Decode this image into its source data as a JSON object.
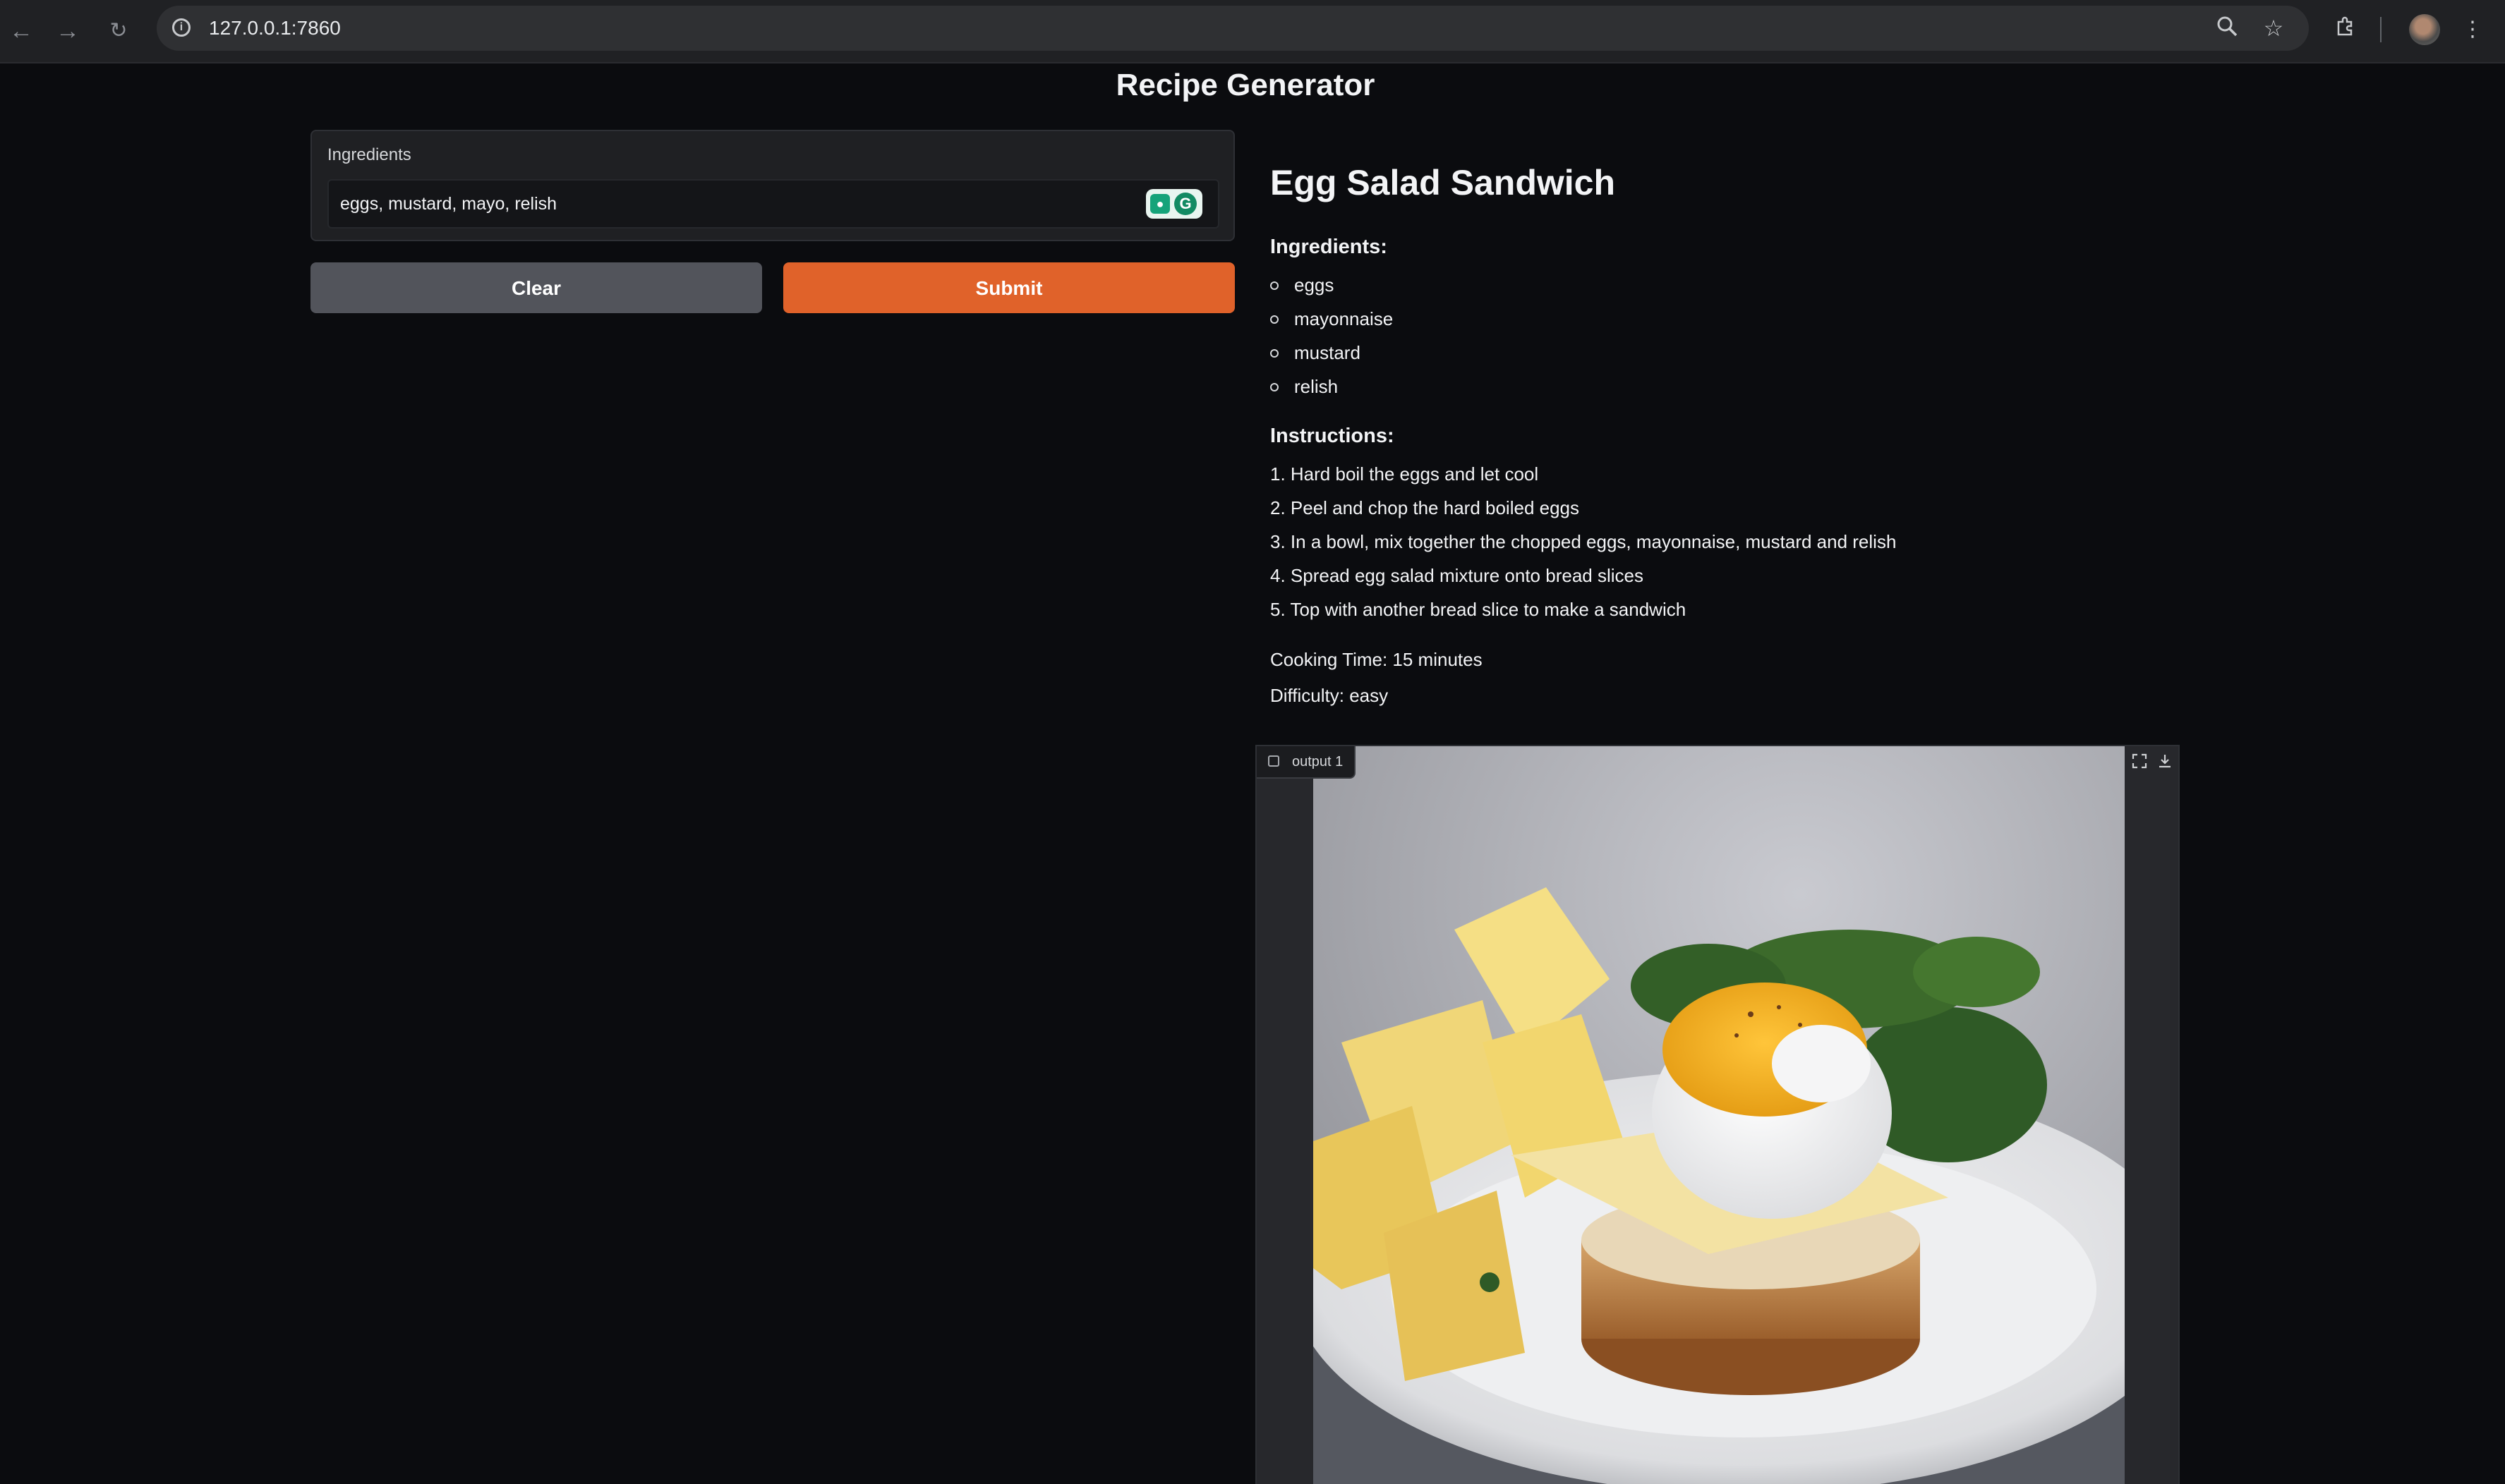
{
  "browser": {
    "url": "127.0.0.1:7860",
    "back_icon": "arrow-left-icon",
    "forward_icon": "arrow-right-icon",
    "reload_icon": "reload-icon"
  },
  "app": {
    "title": "Recipe Generator"
  },
  "input": {
    "label": "Ingredients",
    "value": "eggs, mustard, mayo, relish",
    "placeholder": ""
  },
  "buttons": {
    "clear": "Clear",
    "submit": "Submit"
  },
  "recipe": {
    "title": "Egg Salad Sandwich",
    "ingredients_heading": "Ingredients:",
    "ingredients": [
      "eggs",
      "mayonnaise",
      "mustard",
      "relish"
    ],
    "instructions_heading": "Instructions:",
    "steps": [
      "1. Hard boil the eggs and let cool",
      "2. Peel and chop the hard boiled eggs",
      "3. In a bowl, mix together the chopped eggs, mayonnaise, mustard and relish",
      "4. Spread egg salad mixture onto bread slices",
      "5. Top with another bread slice to make a sandwich"
    ],
    "cooking_time": "Cooking Time: 15 minutes",
    "difficulty": "Difficulty: easy"
  },
  "image_output": {
    "label": "output 1",
    "fullscreen_icon": "fullscreen-icon",
    "download_icon": "download-icon"
  },
  "colors": {
    "background": "#0b0c0f",
    "accent": "#e0622a",
    "secondary_button": "#52545b"
  }
}
